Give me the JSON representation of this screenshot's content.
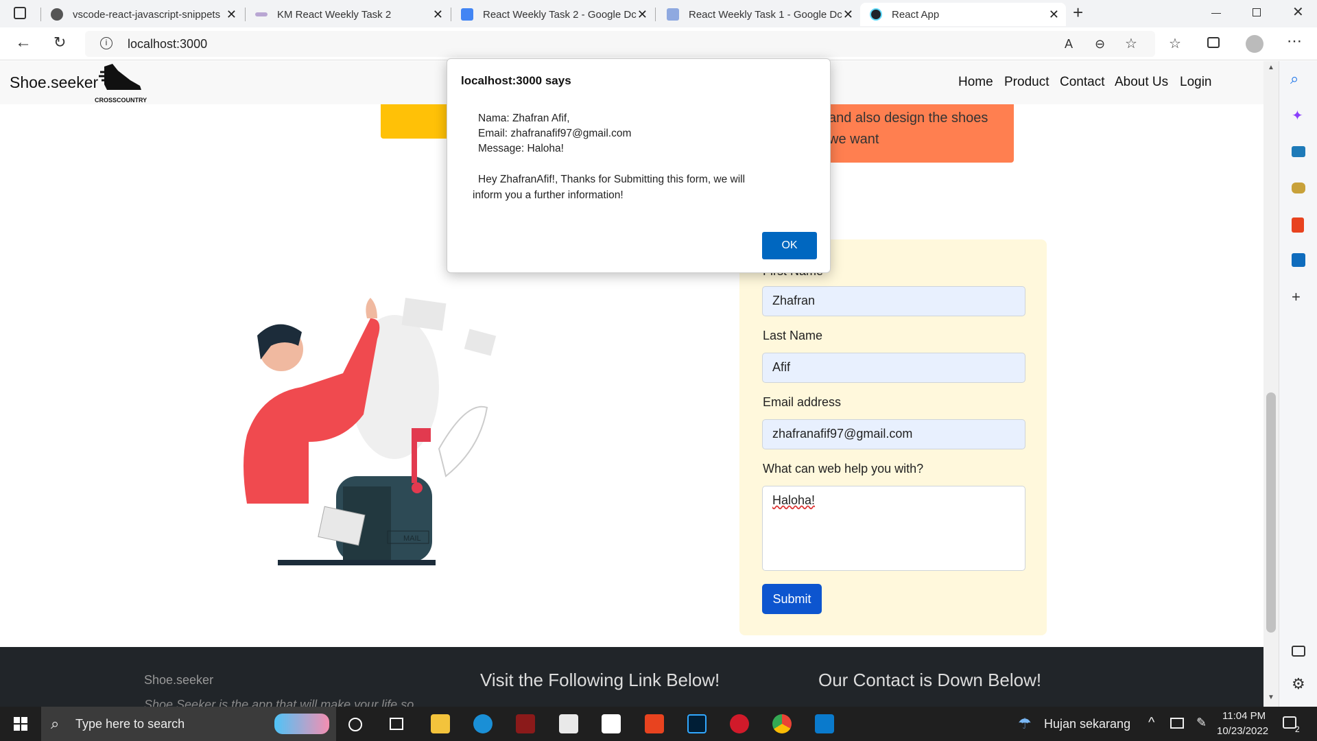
{
  "tabs": [
    {
      "title": "vscode-react-javascript-snippets",
      "close": "✕"
    },
    {
      "title": "KM React Weekly Task 2",
      "close": "✕"
    },
    {
      "title": "React Weekly Task 2 - Google Dc",
      "close": "✕"
    },
    {
      "title": "React Weekly Task 1 - Google Dc",
      "close": "✕"
    },
    {
      "title": "React App",
      "close": "✕"
    }
  ],
  "new_tab": "+",
  "address": {
    "url": "localhost:3000"
  },
  "navbar": {
    "brand": "Shoe.seeker",
    "logo_text": "CROSSCOUNTRY",
    "links": [
      "Home",
      "Product",
      "Contact",
      "About Us",
      "Login"
    ]
  },
  "banner": {
    "line1": "and also design the shoes",
    "line2": "we want"
  },
  "form": {
    "first_name_label": "First Name",
    "first_name_value": "Zhafran",
    "last_name_label": "Last Name",
    "last_name_value": "Afif",
    "email_label": "Email address",
    "email_value": "zhafranafif97@gmail.com",
    "message_label": "What can web help you with?",
    "message_value": "Haloha!",
    "submit": "Submit"
  },
  "illustration": {
    "mailbox_text": "MAIL"
  },
  "dialog": {
    "title": "localhost:3000 says",
    "lines": [
      "Nama: Zhafran Afif,",
      "Email: zhafranafif97@gmail.com",
      "Message: Haloha!",
      "Hey ZhafranAfif!, Thanks for Submitting this form, we will",
      "inform you a further information!"
    ],
    "ok": "OK"
  },
  "footer": {
    "brand": "Shoe.seeker",
    "tagline": "Shoe Seeker is the app that will make your life so",
    "links_title": "Visit the Following Link Below!",
    "contact_title": "Our Contact is Down Below!"
  },
  "taskbar": {
    "search_placeholder": "Type here to search",
    "weather": "Hujan sekarang",
    "time": "11:04 PM",
    "date": "10/23/2022",
    "notification_count": "2"
  },
  "colors": {
    "accent": "#0d55cf",
    "banner_orange": "#ff7f50",
    "banner_yellow": "#ffc107",
    "form_bg": "#fff8dc",
    "footer_bg": "#212529"
  }
}
